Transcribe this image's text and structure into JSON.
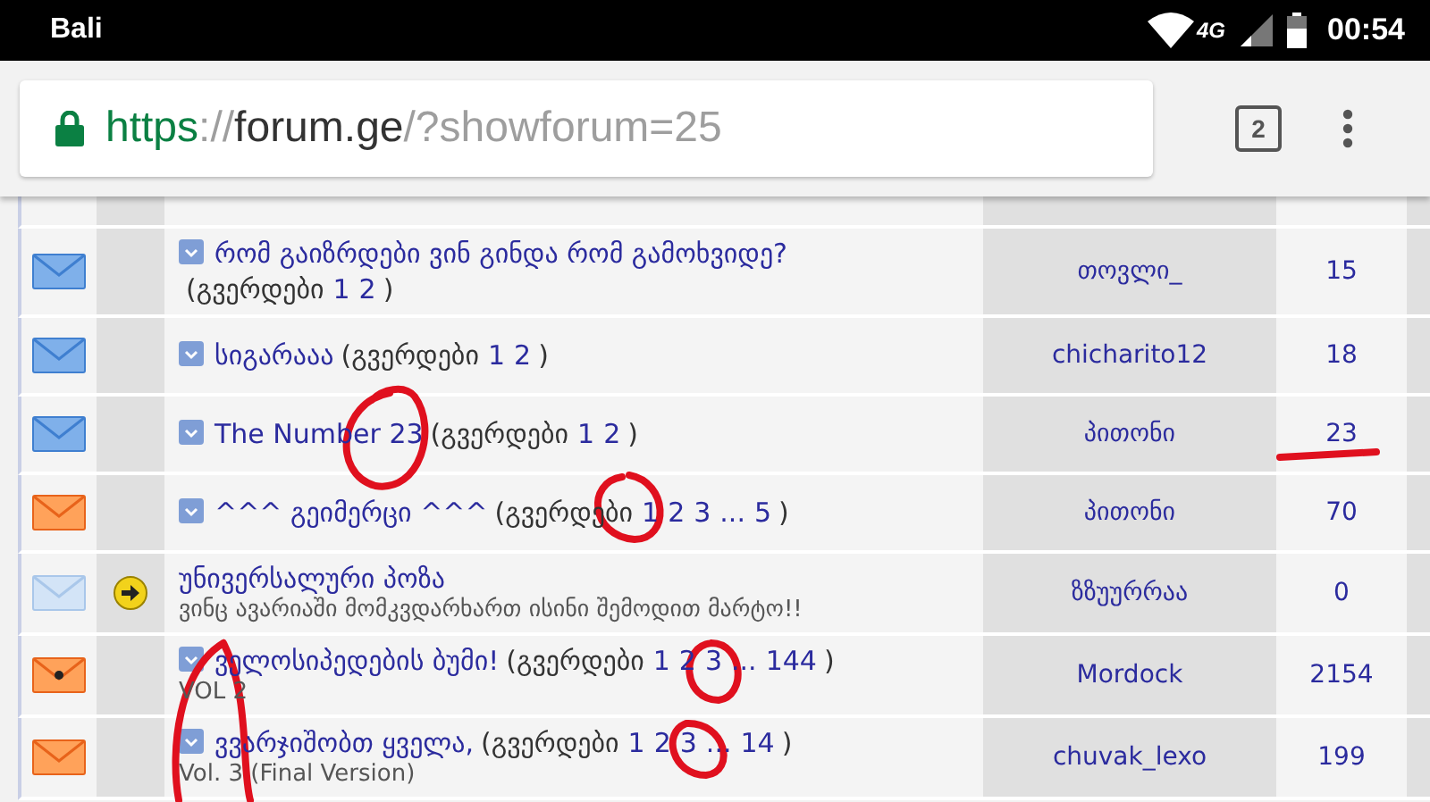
{
  "status_bar": {
    "carrier": "Bali",
    "network": "4G",
    "time": "00:54"
  },
  "browser": {
    "url": {
      "scheme": "https",
      "separator": "://",
      "host": "forum.ge",
      "path": "/?showforum=25"
    },
    "tab_count": "2"
  },
  "topics": [
    {
      "kind": "new",
      "pinned": false,
      "topic_icon": true,
      "title": "რომ გაიზრდები ვინ გინდა რომ გამოხვიდე?",
      "pages_open": "(გვერდები",
      "pages": [
        "1",
        "2"
      ],
      "pages_close": ")",
      "author": "თოვლი_",
      "replies": "15"
    },
    {
      "kind": "new",
      "pinned": false,
      "topic_icon": true,
      "title": "სიგარააა",
      "pages_open": "(გვერდები",
      "pages": [
        "1",
        "2"
      ],
      "pages_close": ")",
      "author": "chicharito12",
      "replies": "18"
    },
    {
      "kind": "new",
      "pinned": false,
      "topic_icon": true,
      "title": "The Number 23",
      "pages_open": "(გვერდები",
      "pages": [
        "1",
        "2"
      ],
      "pages_close": ")",
      "author": "პითონი",
      "replies": "23"
    },
    {
      "kind": "hot",
      "pinned": false,
      "topic_icon": true,
      "title": "^^^ გეიმერცი ^^^",
      "pages_open": "(გვერდები",
      "pages": [
        "1",
        "2",
        "3",
        "...",
        "5"
      ],
      "pages_close": ")",
      "author": "პითონი",
      "replies": "70"
    },
    {
      "kind": "read",
      "pinned": true,
      "topic_icon": false,
      "title": "უნივერსალური პოზა",
      "description": "ვინც ავარიაში მომკვდარხართ ისინი შემოდით მარტო!!",
      "author": "ზზუურრაა",
      "replies": "0"
    },
    {
      "kind": "hot_posted",
      "pinned": false,
      "topic_icon": true,
      "title": "ველოსიპედების ბუმი!",
      "pages_open": "(გვერდები",
      "pages": [
        "1",
        "2",
        "3",
        "...",
        "144"
      ],
      "pages_close": ")",
      "description": "VOL 2",
      "author": "Mordock",
      "replies": "2154"
    },
    {
      "kind": "hot",
      "pinned": false,
      "topic_icon": true,
      "title": "ვვარჯიშობთ ყველა,",
      "pages_open": "(გვერდები",
      "pages": [
        "1",
        "2",
        "3",
        "...",
        "14"
      ],
      "pages_close": ")",
      "description": "Vol. 3 (Final Version)",
      "author": "chuvak_lexo",
      "replies": "199"
    }
  ]
}
